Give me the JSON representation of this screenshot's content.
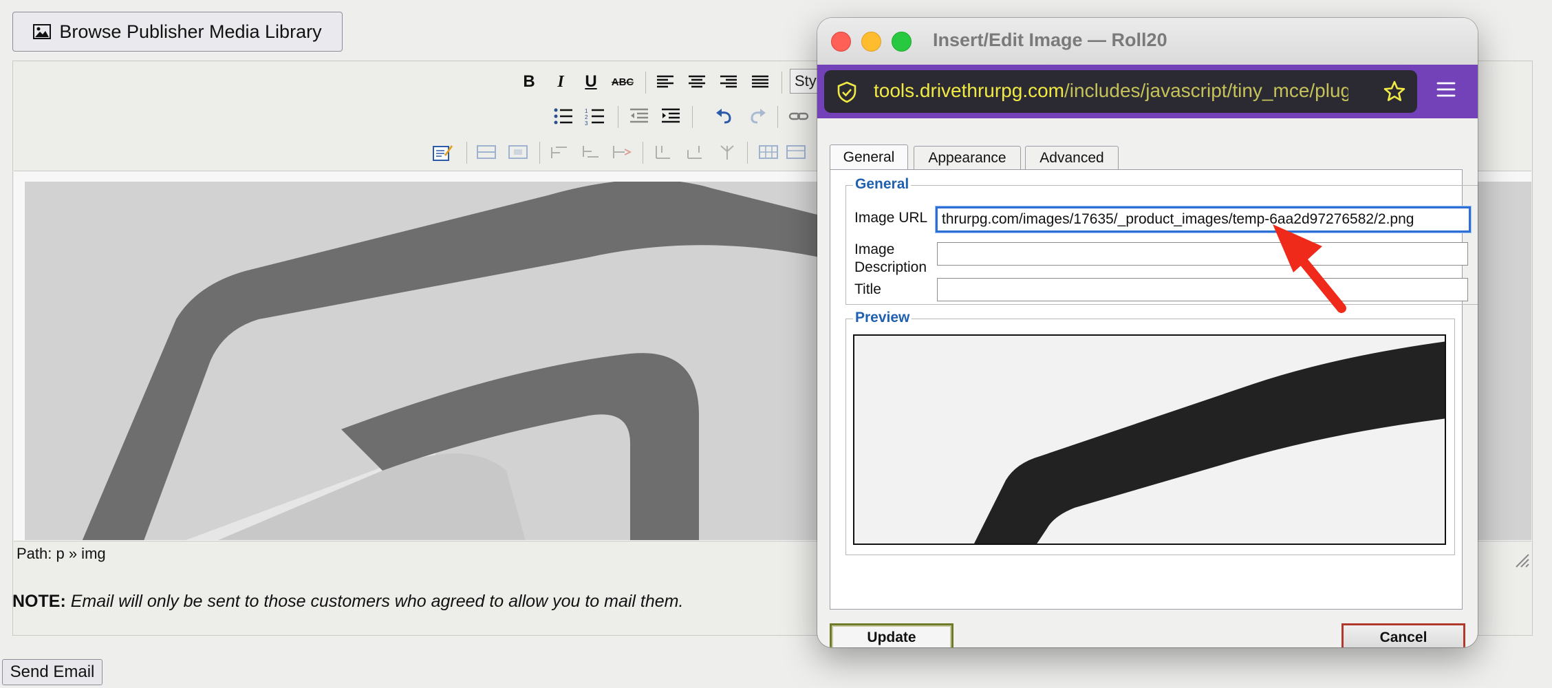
{
  "page": {
    "browse_button_label": "Browse Publisher Media Library",
    "styles_select_value": "Sty",
    "path_text": "Path: p » img",
    "note_label": "NOTE:",
    "note_text": " Email will only be sent to those customers who agreed to allow you to mail them.",
    "send_button_label": "Send Email"
  },
  "toolbar": {
    "bold": "B",
    "italic": "I",
    "underline": "U",
    "strike": "ABC"
  },
  "popup": {
    "title": "Insert/Edit Image — Roll20",
    "url_host": "tools.drivethrurpg.com",
    "url_path": "/includes/javascript/tiny_mce/plug",
    "tabs": [
      {
        "label": "General"
      },
      {
        "label": "Appearance"
      },
      {
        "label": "Advanced"
      }
    ],
    "general_legend": "General",
    "image_url_label": "Image URL",
    "image_url_value": "thrurpg.com/images/17635/_product_images/temp-6aa2d97276582/2.png",
    "image_description_label": "Image Description",
    "image_description_value": "",
    "title_label": "Title",
    "title_value": "",
    "preview_legend": "Preview",
    "update_label": "Update",
    "cancel_label": "Cancel"
  },
  "colors": {
    "browser_accent": "#7442b8",
    "url_host": "#f1ea44",
    "legend_blue": "#2060b0",
    "focus_blue": "#2e6fd6",
    "arrow_red": "#f02a1a"
  }
}
